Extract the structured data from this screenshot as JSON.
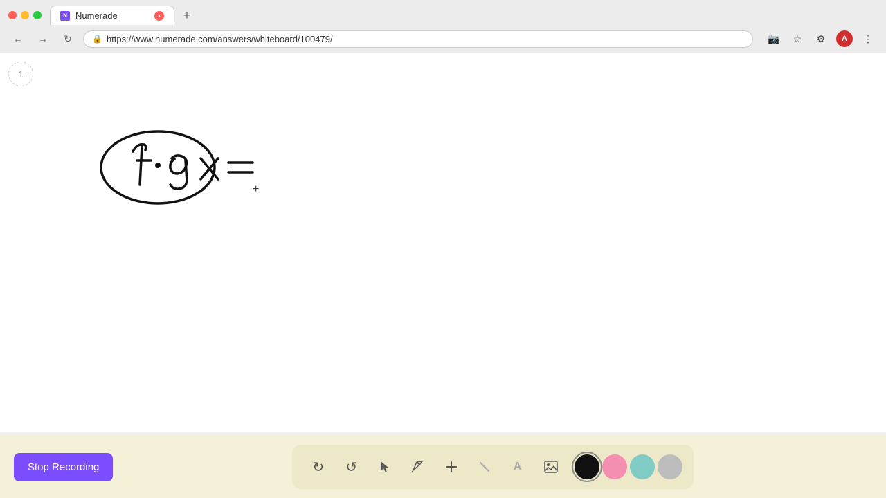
{
  "browser": {
    "tab_title": "Numerade",
    "tab_favicon": "N",
    "url": "https://www.numerade.com/answers/whiteboard/100479/",
    "recording_dot_color": "#ff5f57"
  },
  "page": {
    "number": "1",
    "cursor": "+"
  },
  "toolbar": {
    "stop_recording_label": "Stop Recording",
    "tools": [
      {
        "id": "undo",
        "icon": "↺",
        "label": "Undo"
      },
      {
        "id": "redo",
        "icon": "↻",
        "label": "Redo"
      },
      {
        "id": "select",
        "icon": "▲",
        "label": "Select"
      },
      {
        "id": "pen",
        "icon": "✏",
        "label": "Pen"
      },
      {
        "id": "add",
        "icon": "+",
        "label": "Add"
      },
      {
        "id": "eraser",
        "icon": "/",
        "label": "Eraser"
      },
      {
        "id": "text",
        "icon": "A",
        "label": "Text"
      },
      {
        "id": "image",
        "icon": "🖼",
        "label": "Image"
      }
    ],
    "colors": [
      {
        "id": "black",
        "hex": "#111111",
        "selected": true
      },
      {
        "id": "pink",
        "hex": "#f48fb1",
        "selected": false
      },
      {
        "id": "green",
        "hex": "#80cbc4",
        "selected": false
      },
      {
        "id": "gray",
        "hex": "#bdbdbd",
        "selected": false
      }
    ]
  }
}
